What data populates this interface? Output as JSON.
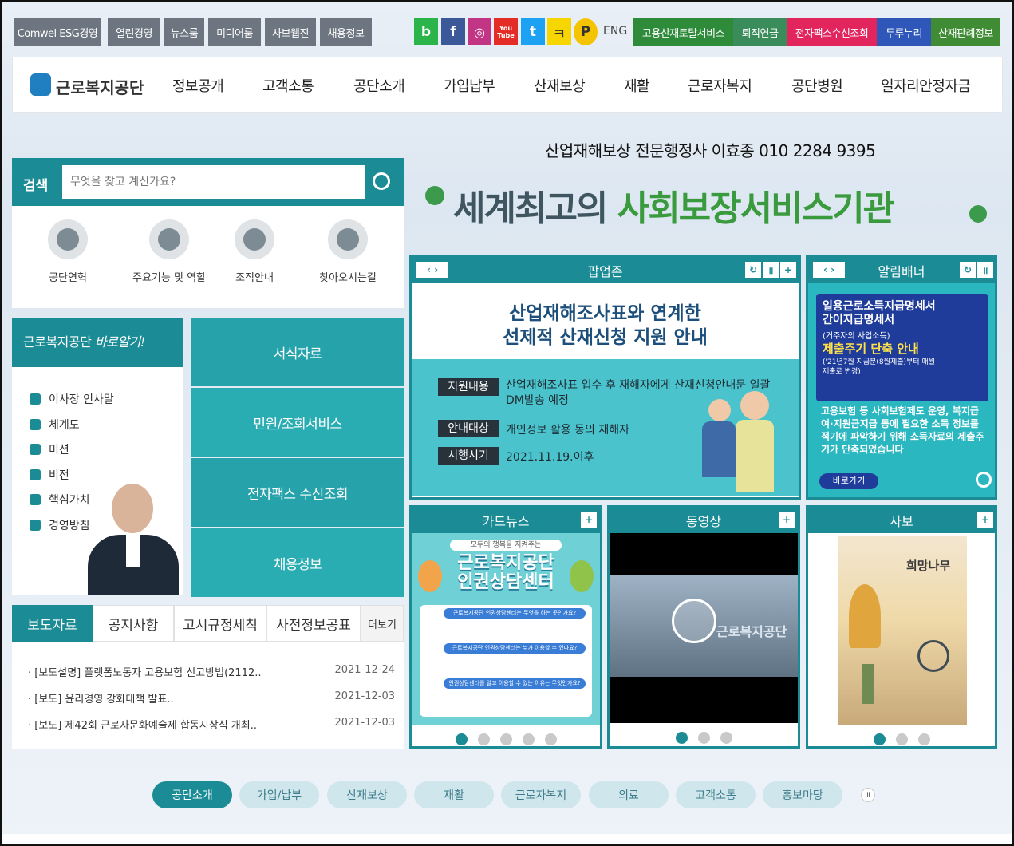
{
  "utility_links": [
    "Comwel ESG경영",
    "열린경영",
    "뉴스룸",
    "미디어룸",
    "사보웹진",
    "채용정보"
  ],
  "sns": [
    {
      "label": "b",
      "color": "#2bb44a"
    },
    {
      "label": "f",
      "color": "#3b5998"
    },
    {
      "label": "◎",
      "color": "#c13584"
    },
    {
      "label": "You Tube",
      "color": "#e52d27"
    },
    {
      "label": "t",
      "color": "#1da1f2"
    },
    {
      "label": "ㅋ",
      "color": "#f7d600"
    },
    {
      "label": "P",
      "color": "#f5c400"
    }
  ],
  "eng_label": "ENG",
  "quick_services": [
    {
      "label": "고용산재토탈서비스",
      "color": "#2e8b3a"
    },
    {
      "label": "퇴직연금",
      "color": "#3a8d5b"
    },
    {
      "label": "전자팩스수신조회",
      "color": "#e3255e"
    },
    {
      "label": "두루누리",
      "color": "#2f57b9"
    },
    {
      "label": "산재판례정보",
      "color": "#3f8c35"
    }
  ],
  "logo_text": "근로복지공단",
  "nav": [
    "정보공개",
    "고객소통",
    "공단소개",
    "가입납부",
    "산재보상",
    "재활",
    "근로자복지",
    "공단병원",
    "일자리안정자금"
  ],
  "contact_note": "산업재해보상 전문행정사 이효종 010 2284 9395",
  "slogan": {
    "part1": "세계최고의 ",
    "part2": "사회보장서비스기관"
  },
  "search": {
    "label": "검색",
    "placeholder": "무엇을 찾고 계신가요?"
  },
  "quick_icons": [
    "공단연혁",
    "주요기능 및 역할",
    "조직안내",
    "찾아오시는길"
  ],
  "about": {
    "title_a": "근로복지공단 ",
    "title_b": "바로알기!",
    "items": [
      "이사장 인사말",
      "체계도",
      "미션",
      "비전",
      "핵심가치",
      "경영방침"
    ]
  },
  "tiles": [
    "서식자료",
    "민원/조회서비스",
    "전자팩스 수신조회",
    "채용정보"
  ],
  "news": {
    "tabs": [
      "보도자료",
      "공지사항",
      "고시규정세칙",
      "사전정보공표"
    ],
    "more": "더보기",
    "items": [
      {
        "title": "[보도설명] 플랫폼노동자 고용보험 신고방법(2112..",
        "date": "2021-12-24"
      },
      {
        "title": "[보도] 윤리경영 강화대책 발표..",
        "date": "2021-12-03"
      },
      {
        "title": "[보도] 제42회 근로자문화예술제 합동시상식 개최..",
        "date": "2021-12-03"
      }
    ]
  },
  "popup": {
    "title": "팝업존",
    "headline1": "산업재해조사표와 연계한",
    "headline2": "선제적 산재신청 지원 안내",
    "rows": [
      {
        "k": "지원내용",
        "v": "산업재해조사표 입수 후 재해자에게 산재신청안내문 일괄 DM발송 예정"
      },
      {
        "k": "안내대상",
        "v": "개인정보 활용 동의 재해자"
      },
      {
        "k": "시행시기",
        "v": "2021.11.19.이후"
      }
    ]
  },
  "banner": {
    "title": "알림배너",
    "l1": "일용근로소득지급명세서",
    "l2": "간이지급명세서",
    "l3": "(거주자의 사업소득)",
    "l4": "제출주기 단축 안내",
    "l5": "('21년7월 지급분(8월제출)부터 매월 제출로 변경)",
    "body": "고용보험 등 사회보험제도 운영, 복지급여·지원금지급 등에 필요한 소득 정보를 적기에 파악하기 위해 소득자료의 제출주기가 단축되었습니다",
    "go": "바로가기"
  },
  "card": {
    "title": "카드뉴스",
    "small": "모두의 행복을 지켜주는",
    "big1": "근로복지공단",
    "big2": "인권상담센터",
    "q1": "근로복지공단 인권상담센터는 무엇을 하는 곳인가요?",
    "q2": "근로복지공단 인권상담센터는 누가 이용할 수 있나요?",
    "q3": "인권상담센터를 알고 이용할 수 있는 이유는 무엇인가요?",
    "foot": "근로복지공단"
  },
  "video": {
    "title": "동영상",
    "caption": "근로복지공단"
  },
  "sabo": {
    "title": "사보",
    "mag": "희망나무"
  },
  "bottom_tabs": [
    "공단소개",
    "가입/납부",
    "산재보상",
    "재활",
    "근로자복지",
    "의료",
    "고객소통",
    "홍보마당"
  ]
}
